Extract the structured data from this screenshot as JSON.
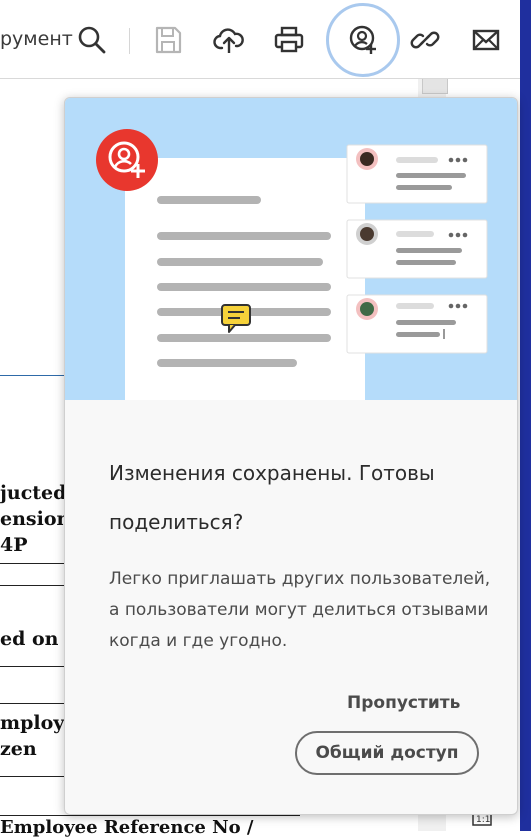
{
  "toolbar": {
    "tool_label": "румент",
    "icons": [
      "search-icon",
      "save-icon",
      "upload-icon",
      "print-icon",
      "share-user-icon",
      "link-icon",
      "mail-icon"
    ]
  },
  "document": {
    "lines": [
      "jucted",
      "ension/",
      "4P",
      "ed on",
      "mploy",
      "zen",
      "Employee Reference No /"
    ]
  },
  "popover": {
    "title": "Изменения сохранены. Готовы поделиться?",
    "description": "Легко приглашать других пользователей, а пользователи могут делиться отзывами когда и где угодно.",
    "skip_label": "Пропустить",
    "share_label": "Общий доступ"
  },
  "colors": {
    "accent_red": "#e8372e",
    "hero_blue": "#b5dcfa",
    "ring_blue": "#a9c9ee",
    "edge_blue": "#1f2f9e"
  }
}
